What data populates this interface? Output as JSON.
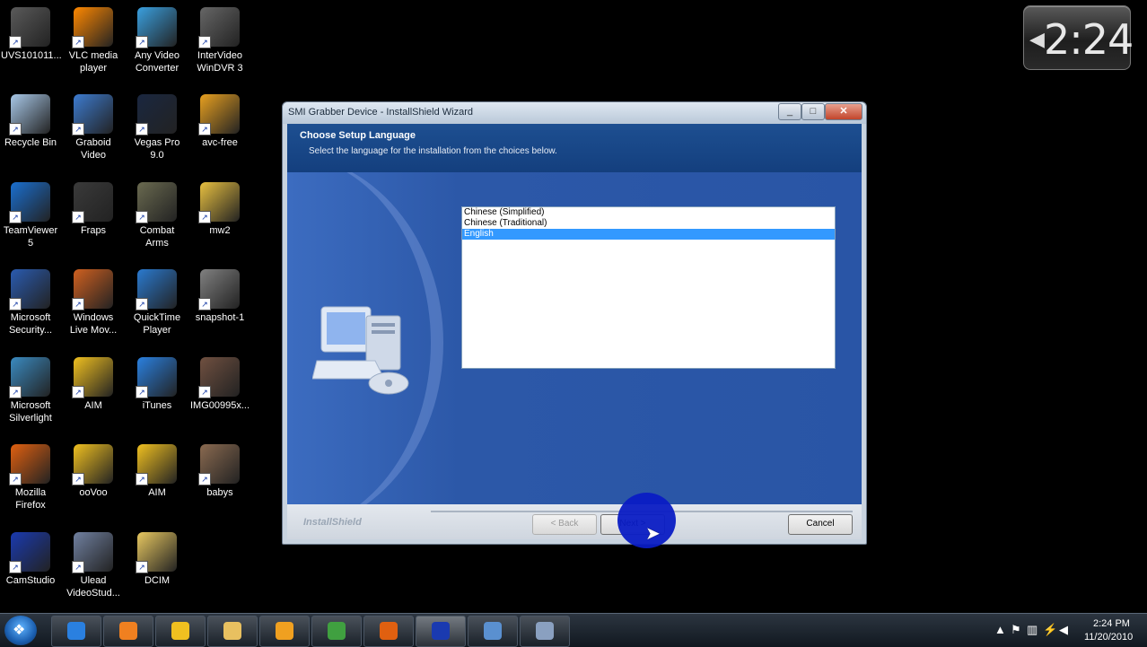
{
  "desktop_icons": [
    {
      "name": "uvs-file",
      "label": "UVS101011...",
      "color": "#5a5a5a"
    },
    {
      "name": "vlc",
      "label": "VLC media\nplayer",
      "color": "#ff8800"
    },
    {
      "name": "any-video-converter",
      "label": "Any Video\nConverter",
      "color": "#3aa0e0"
    },
    {
      "name": "intervideo-windvr",
      "label": "InterVideo\nWinDVR 3",
      "color": "#666666"
    },
    {
      "name": "recycle-bin",
      "label": "Recycle Bin",
      "color": "#a8c8e8"
    },
    {
      "name": "graboid",
      "label": "Graboid\nVideo",
      "color": "#3d7bd0"
    },
    {
      "name": "vegas-pro",
      "label": "Vegas Pro 9.0",
      "color": "#1a2740"
    },
    {
      "name": "avc-free",
      "label": "avc-free",
      "color": "#e8a020"
    },
    {
      "name": "teamviewer",
      "label": "TeamViewer\n5",
      "color": "#1a6fd0"
    },
    {
      "name": "fraps",
      "label": "Fraps",
      "color": "#3a3a3a"
    },
    {
      "name": "combat-arms",
      "label": "Combat\nArms",
      "color": "#6a6a50"
    },
    {
      "name": "mw2",
      "label": "mw2",
      "color": "#e8c040"
    },
    {
      "name": "microsoft-security",
      "label": "Microsoft\nSecurity...",
      "color": "#2a5bb0"
    },
    {
      "name": "windows-live-movie",
      "label": "Windows\nLive Mov...",
      "color": "#d06020"
    },
    {
      "name": "quicktime",
      "label": "QuickTime\nPlayer",
      "color": "#2a7ad0"
    },
    {
      "name": "snapshot",
      "label": "snapshot-1",
      "color": "#808080"
    },
    {
      "name": "silverlight",
      "label": "Microsoft\nSilverlight",
      "color": "#3a8ac0"
    },
    {
      "name": "aim-1",
      "label": "AIM",
      "color": "#f0c020"
    },
    {
      "name": "itunes",
      "label": "iTunes",
      "color": "#2a80e0"
    },
    {
      "name": "img-file",
      "label": "IMG00995x...",
      "color": "#705040"
    },
    {
      "name": "firefox",
      "label": "Mozilla\nFirefox",
      "color": "#e06010"
    },
    {
      "name": "oovoo",
      "label": "ooVoo",
      "color": "#f0c020"
    },
    {
      "name": "aim-2",
      "label": "AIM",
      "color": "#f0c020"
    },
    {
      "name": "babys",
      "label": "babys",
      "color": "#8a6a50"
    },
    {
      "name": "camstudio",
      "label": "CamStudio",
      "color": "#1a3ab0"
    },
    {
      "name": "ulead-videostudio",
      "label": "Ulead\nVideoStud...",
      "color": "#7080a0"
    },
    {
      "name": "dcim",
      "label": "DCIM",
      "color": "#e8c860"
    }
  ],
  "clock_gadget": {
    "time": "2:24"
  },
  "dialog": {
    "title": "SMI Grabber Device - InstallShield Wizard",
    "heading": "Choose Setup Language",
    "subheading": "Select the language for the installation from the choices below.",
    "languages": [
      "Chinese (Simplified)",
      "Chinese (Traditional)",
      "English"
    ],
    "selected_language": "English",
    "brand": "InstallShield",
    "back_label": "< Back",
    "next_label": "Next >",
    "cancel_label": "Cancel"
  },
  "taskbar": {
    "items": [
      {
        "name": "internet-explorer",
        "color": "#2a80e0"
      },
      {
        "name": "media-player",
        "color": "#f08020"
      },
      {
        "name": "aim",
        "color": "#f0c020"
      },
      {
        "name": "explorer",
        "color": "#e8c060"
      },
      {
        "name": "app-orange",
        "color": "#f0a020"
      },
      {
        "name": "app-green",
        "color": "#40a040"
      },
      {
        "name": "firefox",
        "color": "#e06010"
      },
      {
        "name": "camstudio",
        "color": "#1a3ab0"
      },
      {
        "name": "network-app",
        "color": "#5a90d0"
      },
      {
        "name": "installer",
        "color": "#8aa0c0"
      }
    ],
    "tray_time": "2:24 PM",
    "tray_date": "11/20/2010"
  }
}
